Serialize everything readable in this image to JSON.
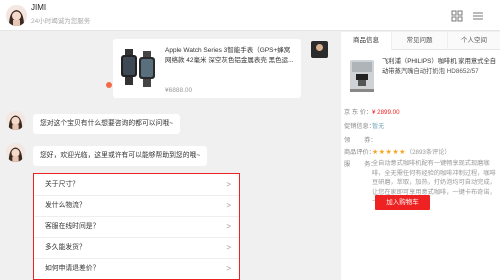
{
  "header": {
    "name": "JIMI",
    "subtitle": "24小时竭诚为您服务"
  },
  "product_card": {
    "title": "Apple Watch Series 3智能手表（GPS+蜂窝网络款 42毫米 深空灰色铝金属表壳 黑色运...",
    "price": "¥6888.00"
  },
  "messages": [
    {
      "text": "您对这个宝贝有什么想要咨询的都可以问哦~"
    },
    {
      "text": "您好，欢迎光临，这里或许有可以能够帮助到您的哦~"
    }
  ],
  "faq": [
    {
      "label": "关于尺寸？"
    },
    {
      "label": "发什么物流？"
    },
    {
      "label": "客服在线时间是？"
    },
    {
      "label": "多久能发货？"
    },
    {
      "label": "如何申请退差价？"
    }
  ],
  "panel": {
    "tabs": [
      {
        "label": "商品信息"
      },
      {
        "label": "常见问题"
      },
      {
        "label": "个人空间"
      }
    ],
    "product_title_main": "飞利浦（PHILIPS）咖啡机 家用意式全自动带蒸汽",
    "product_title_rest": "嘴自动打奶泡 HD8652/57",
    "price_label": "京 东 价：",
    "price": "¥ 2899.00",
    "promo_label": "促销信息：",
    "promo_value": "暂无",
    "coupon_label": "领",
    "coupon_value": "券：",
    "rating_label": "商品评价：",
    "stars": "★★★★★",
    "rating_count": "（2893条评论）",
    "desc_label": "服",
    "desc_label2": "务：",
    "description": "全自动意式咖啡机配有一键畅享现式现磨咖啡，全无需任何有经验的咖啡冲制过程，咖啡豆研磨，萃取，加热，打奶泡均可自动完成，让您在家即可享用意式咖啡，一键卡布奇诺，一键拿铁，口味控制",
    "buy_label": "加入购物车"
  },
  "colors": {
    "accent": "#e22222",
    "star": "#f5a623"
  }
}
